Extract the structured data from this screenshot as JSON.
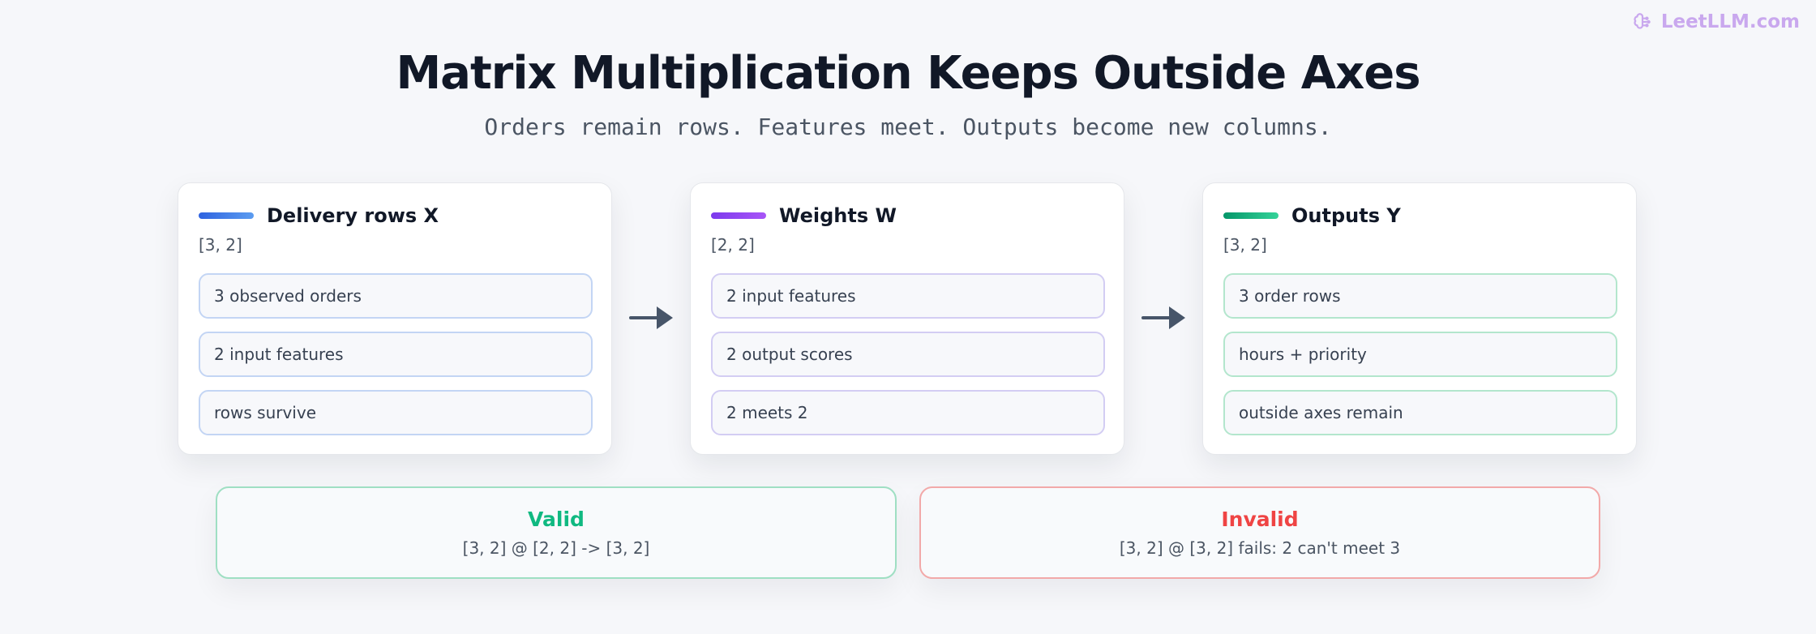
{
  "brand": {
    "text": "LeetLLM.com",
    "icon": "brain-icon",
    "color": "#c9a8ee"
  },
  "header": {
    "title": "Matrix Multiplication Keeps Outside Axes",
    "subtitle": "Orders remain rows. Features meet. Outputs become new columns."
  },
  "cards": [
    {
      "title": "Delivery rows X",
      "shape": "[3, 2]",
      "accent": [
        "#2f63e0",
        "#5b9cf0"
      ],
      "items": [
        "3 observed orders",
        "2 input features",
        "rows survive"
      ]
    },
    {
      "title": "Weights W",
      "shape": "[2, 2]",
      "accent": [
        "#7c3aed",
        "#a855f7"
      ],
      "items": [
        "2 input features",
        "2 output scores",
        "2 meets 2"
      ]
    },
    {
      "title": "Outputs Y",
      "shape": "[3, 2]",
      "accent": [
        "#059669",
        "#34d399"
      ],
      "items": [
        "3 order rows",
        "hours + priority",
        "outside axes remain"
      ]
    }
  ],
  "arrows": [
    "arrow-right-icon",
    "arrow-right-icon"
  ],
  "verdicts": {
    "valid": {
      "title": "Valid",
      "text": "[3, 2] @ [2, 2] -> [3, 2]",
      "color": "#10b981"
    },
    "invalid": {
      "title": "Invalid",
      "text": "[3, 2] @ [3, 2] fails: 2 can't meet 3",
      "color": "#ef4444"
    }
  }
}
